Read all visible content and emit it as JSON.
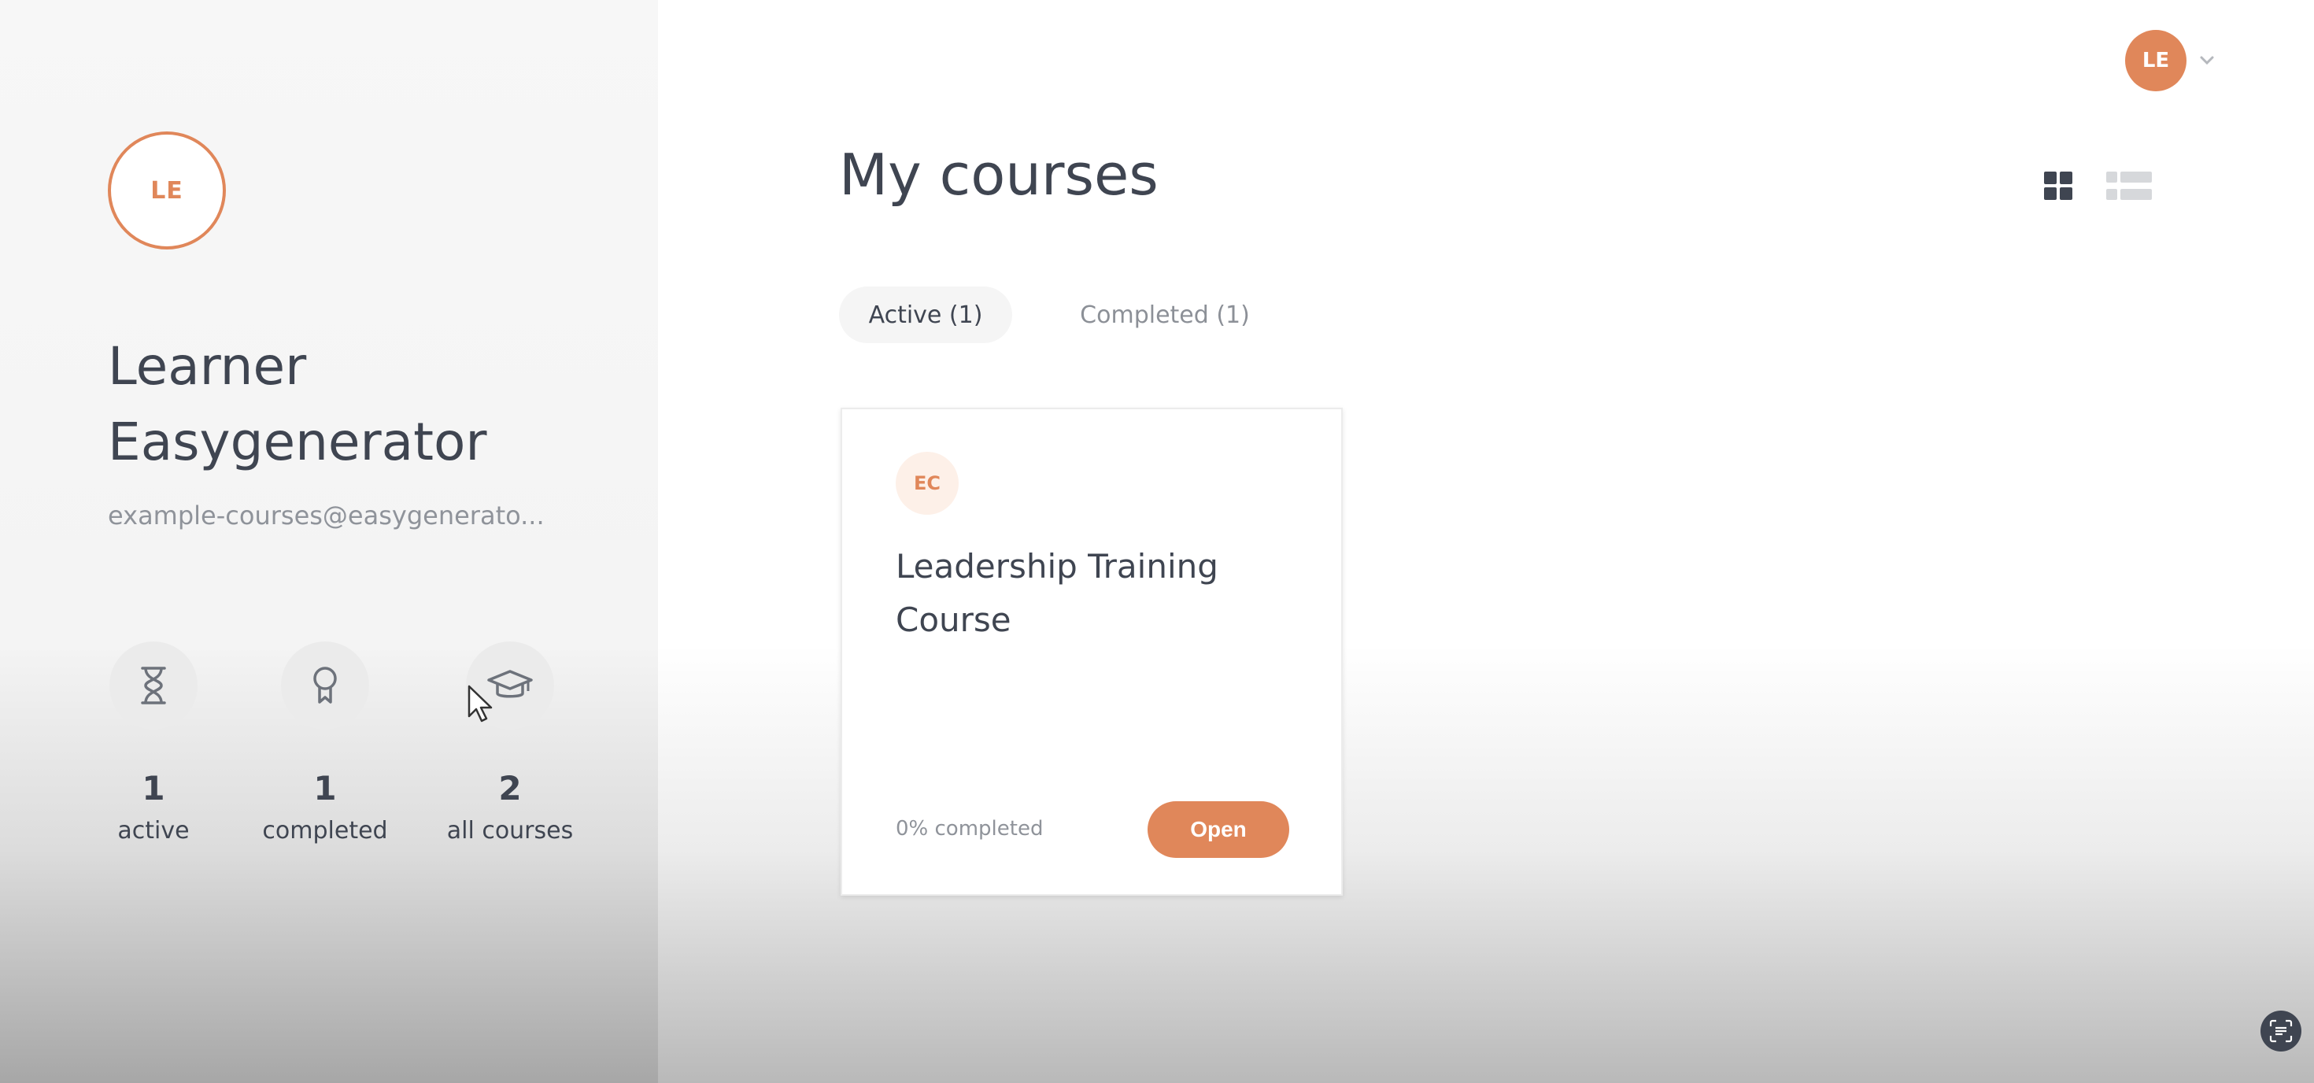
{
  "user": {
    "initials": "LE",
    "name": "Learner Easygenerator",
    "email": "example-courses@easygenerato..."
  },
  "stats": [
    {
      "icon": "hourglass-icon",
      "value": "1",
      "label": "active"
    },
    {
      "icon": "award-icon",
      "value": "1",
      "label": "completed"
    },
    {
      "icon": "graduation-cap-icon",
      "value": "2",
      "label": "all courses"
    }
  ],
  "header": {
    "title": "My courses",
    "view_modes": [
      "grid",
      "list"
    ],
    "selected_view": "grid"
  },
  "tabs": [
    {
      "label": "Active (1)",
      "selected": true
    },
    {
      "label": "Completed (1)",
      "selected": false
    }
  ],
  "courses": [
    {
      "badge": "EC",
      "title": "Leadership Training Course",
      "progress": "0% completed",
      "action": "Open"
    }
  ],
  "colors": {
    "accent": "#e0875a",
    "text": "#3f4551",
    "muted": "#8f939a"
  }
}
